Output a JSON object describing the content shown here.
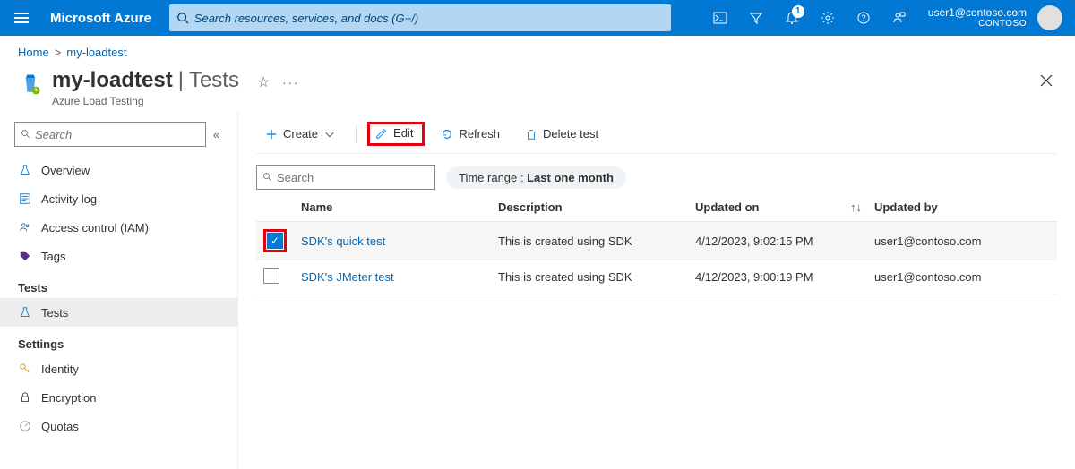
{
  "brand": "Microsoft Azure",
  "search_placeholder": "Search resources, services, and docs (G+/)",
  "notification_count": "1",
  "user": {
    "email": "user1@contoso.com",
    "tenant": "CONTOSO"
  },
  "breadcrumb": {
    "home": "Home",
    "current": "my-loadtest"
  },
  "title": {
    "main": "my-loadtest",
    "section": "Tests",
    "subtitle": "Azure Load Testing"
  },
  "sidebar": {
    "search_placeholder": "Search",
    "items": [
      {
        "label": "Overview"
      },
      {
        "label": "Activity log"
      },
      {
        "label": "Access control (IAM)"
      },
      {
        "label": "Tags"
      }
    ],
    "group_tests": {
      "heading": "Tests",
      "items": [
        {
          "label": "Tests"
        }
      ]
    },
    "group_settings": {
      "heading": "Settings",
      "items": [
        {
          "label": "Identity"
        },
        {
          "label": "Encryption"
        },
        {
          "label": "Quotas"
        }
      ]
    }
  },
  "toolbar": {
    "create": "Create",
    "edit": "Edit",
    "refresh": "Refresh",
    "delete": "Delete test"
  },
  "content_search_placeholder": "Search",
  "time_range": {
    "label": "Time range : ",
    "value": "Last one month"
  },
  "table": {
    "headers": {
      "name": "Name",
      "description": "Description",
      "updated_on": "Updated on",
      "updated_by": "Updated by"
    },
    "rows": [
      {
        "selected": true,
        "name": "SDK's quick test",
        "description": "This is created using SDK",
        "updated_on": "4/12/2023, 9:02:15 PM",
        "updated_by": "user1@contoso.com"
      },
      {
        "selected": false,
        "name": "SDK's JMeter test",
        "description": "This is created using SDK",
        "updated_on": "4/12/2023, 9:00:19 PM",
        "updated_by": "user1@contoso.com"
      }
    ]
  }
}
